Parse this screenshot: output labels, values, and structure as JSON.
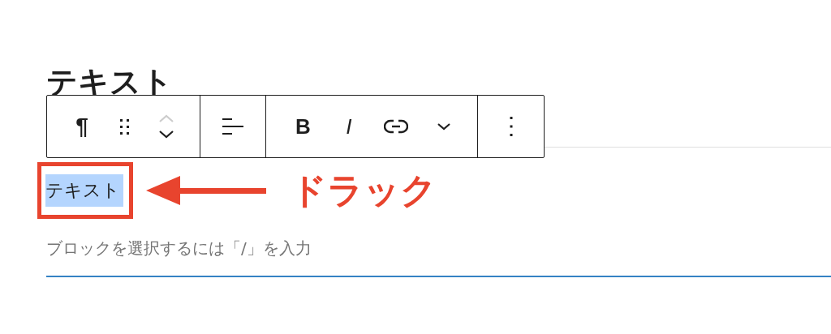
{
  "heading": "テキスト",
  "toolbar": {
    "groups": [
      [
        {
          "kind": "paragraph",
          "label": "¶"
        },
        {
          "kind": "drag"
        },
        {
          "kind": "mover",
          "up_disabled": true
        }
      ],
      [
        {
          "kind": "align"
        }
      ],
      [
        {
          "kind": "bold",
          "label": "B"
        },
        {
          "kind": "italic",
          "label": "I"
        },
        {
          "kind": "link"
        },
        {
          "kind": "more"
        }
      ],
      [
        {
          "kind": "options"
        }
      ]
    ]
  },
  "paragraph": {
    "text": "テキスト",
    "selected": true
  },
  "annotation": {
    "label": "ドラック"
  },
  "next_block": {
    "placeholder": "ブロックを選択するには「/」を入力"
  }
}
